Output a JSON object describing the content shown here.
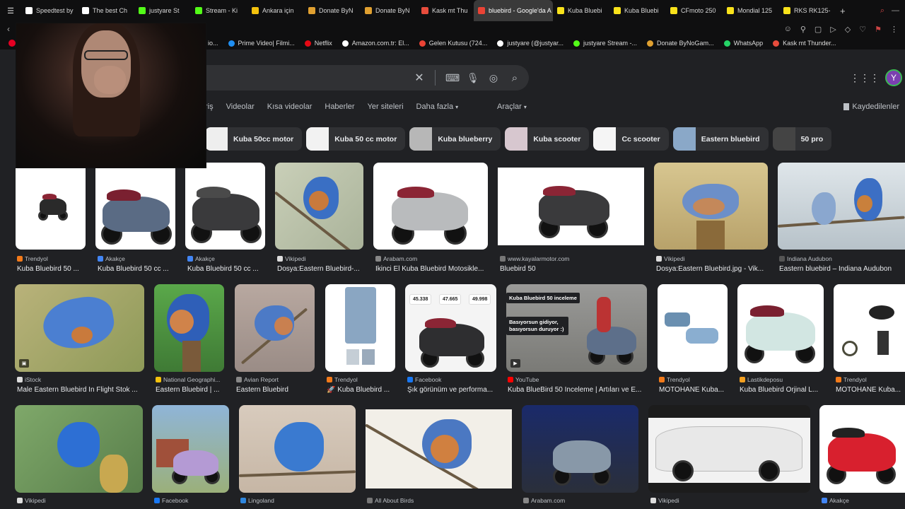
{
  "browser": {
    "tabs": [
      {
        "label": "Speedtest by",
        "color": "#ffffff"
      },
      {
        "label": "The best Ch",
        "color": "#ffffff"
      },
      {
        "label": "justyare St",
        "color": "#53fc18"
      },
      {
        "label": "Stream - Ki",
        "color": "#53fc18"
      },
      {
        "label": "Ankara için",
        "color": "#f4c20d"
      },
      {
        "label": "Donate ByN",
        "color": "#e0a030"
      },
      {
        "label": "Donate ByN",
        "color": "#e0a030"
      },
      {
        "label": "Kask mt Thu",
        "color": "#e74c3c"
      },
      {
        "label": "bluebird - Google'da A",
        "color": "#ea4335"
      },
      {
        "label": "Kuba Bluebi",
        "color": "#f9e21b"
      },
      {
        "label": "Kuba Bluebi",
        "color": "#f9e21b"
      },
      {
        "label": "CFmoto 250",
        "color": "#f9e21b"
      },
      {
        "label": "Mondial 125",
        "color": "#f9e21b"
      },
      {
        "label": "RKS RK125-",
        "color": "#f9e21b"
      }
    ],
    "bookmarks": [
      {
        "label": "Prime Video| Filmi...",
        "color": "#1f8ef1"
      },
      {
        "label": "Netflix",
        "color": "#e50914"
      },
      {
        "label": "Amazon.com.tr: El...",
        "color": "#ffffff"
      },
      {
        "label": "Gelen Kutusu (724...",
        "color": "#ea4335"
      },
      {
        "label": "justyare (@justyar...",
        "color": "#ffffff"
      },
      {
        "label": "justyare Stream -...",
        "color": "#53fc18"
      },
      {
        "label": "Donate ByNoGam...",
        "color": "#e0a030"
      },
      {
        "label": "WhatsApp",
        "color": "#25d366"
      },
      {
        "label": "Kask mt Thunder...",
        "color": "#e74c3c"
      }
    ],
    "bookmark_fragment": "io..."
  },
  "search": {
    "avatar_letter": "Y",
    "nav_tabs": [
      "riş",
      "Videolar",
      "Kısa videolar",
      "Haberler",
      "Yer siteleri",
      "Daha fazla"
    ],
    "tools_label": "Araçlar",
    "saved_label": "Kaydedilenler",
    "chips": [
      "Kuba 50cc motor",
      "Kuba 50 cc motor",
      "Kuba blueberry",
      "Kuba scooter",
      "Cc scooter",
      "Eastern bluebird",
      "50 pro"
    ]
  },
  "results": {
    "row1": [
      {
        "source": "Trendyol",
        "caption": "Kuba Bluebird 50 ..."
      },
      {
        "source": "Akakçe",
        "caption": "Kuba Bluebird 50 cc ..."
      },
      {
        "source": "Akakçe",
        "caption": "Kuba Bluebird 50 cc ..."
      },
      {
        "source": "Vikipedi",
        "caption": "Dosya:Eastern Bluebird-..."
      },
      {
        "source": "Arabam.com",
        "caption": "İkinci El Kuba Bluebird Motosikle..."
      },
      {
        "source": "www.kayalarmotor.com",
        "caption": "Bluebird 50"
      },
      {
        "source": "Vikipedi",
        "caption": "Dosya:Eastern Bluebird.jpg - Vik..."
      },
      {
        "source": "Indiana Audubon",
        "caption": "Eastern bluebird – Indiana Audubon"
      }
    ],
    "row2": [
      {
        "source": "iStock",
        "caption": "Male Eastern Bluebird In Flight Stok ..."
      },
      {
        "source": "National Geographi...",
        "caption": "Eastern Bluebird | ..."
      },
      {
        "source": "Avian Report",
        "caption": "Eastern Bluebird"
      },
      {
        "source": "Trendyol",
        "caption": "🚀 Kuba Bluebird ..."
      },
      {
        "source": "Facebook",
        "caption": "Şık görünüm ve performa..."
      },
      {
        "source": "YouTube",
        "caption": "Kuba BlueBird 50 İnceleme | Artıları ve E..."
      },
      {
        "source": "Trendyol",
        "caption": "MOTOHANE Kuba..."
      },
      {
        "source": "Lastikdeposu",
        "caption": "Kuba Bluebird Orjinal L..."
      },
      {
        "source": "Trendyol",
        "caption": "MOTOHANE Kuba..."
      }
    ],
    "row3": [
      {
        "source": "Vikipedi"
      },
      {
        "source": "Facebook"
      },
      {
        "source": "Lingoland"
      },
      {
        "source": "All About Birds"
      },
      {
        "source": "Arabam.com"
      },
      {
        "source": "Vikipedi"
      },
      {
        "source": "Akakçe"
      }
    ],
    "video_title": "Kuba Bluebird 50 inceleme",
    "video_subtitle": "Basıyorsun gidiyor, basıyorsun duruyor :)",
    "prices": [
      "45.338",
      "47.665",
      "49.998"
    ]
  }
}
